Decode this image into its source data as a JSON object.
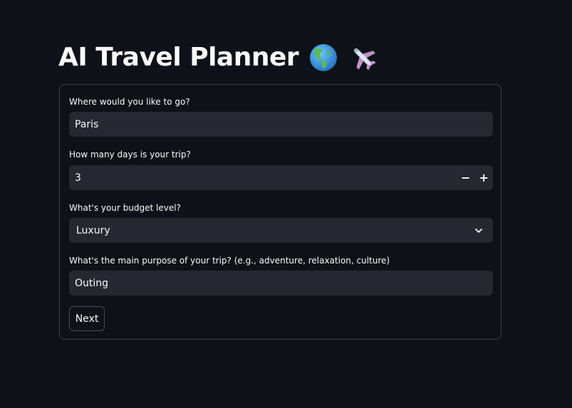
{
  "header": {
    "title": "AI Travel Planner",
    "emojis": [
      "globe-americas-icon",
      "airplane-icon"
    ]
  },
  "form": {
    "destination": {
      "label": "Where would you like to go?",
      "value": "Paris"
    },
    "days": {
      "label": "How many days is your trip?",
      "value": "3",
      "minus": "−",
      "plus": "+"
    },
    "budget": {
      "label": "What's your budget level?",
      "selected": "Luxury"
    },
    "purpose": {
      "label": "What's the main purpose of your trip? (e.g., adventure, relaxation, culture)",
      "value": "Outing"
    },
    "submit_label": "Next"
  },
  "colors": {
    "background": "#0e1117",
    "input_bg": "#262730",
    "text": "#fafafa"
  }
}
